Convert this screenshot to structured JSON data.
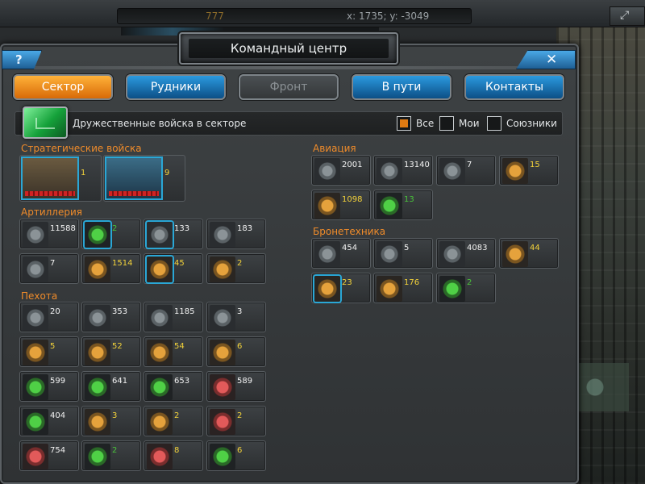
{
  "topbar": {
    "value": "777",
    "coords": "x: 1735; y: -3049"
  },
  "window": {
    "title": "Командный центр",
    "help": "?",
    "close": "✕"
  },
  "tabs": [
    {
      "label": "Сектор"
    },
    {
      "label": "Рудники"
    },
    {
      "label": "Фронт"
    },
    {
      "label": "В пути"
    },
    {
      "label": "Контакты"
    }
  ],
  "filter": {
    "label": "Дружественные войска в секторе",
    "options": [
      "Все",
      "Мои",
      "Союзники"
    ]
  },
  "sections": {
    "strategic": "Стратегические войска",
    "artillery": "Артиллерия",
    "infantry": "Пехота",
    "aviation": "Авиация",
    "armor": "Бронетехника"
  },
  "strategic": [
    "1",
    "9"
  ],
  "artillery": [
    "11588",
    "2",
    "133",
    "183",
    "7",
    "1514",
    "45",
    "2"
  ],
  "infantry": [
    "20",
    "353",
    "1185",
    "3",
    "5",
    "52",
    "54",
    "6",
    "599",
    "641",
    "653",
    "589",
    "404",
    "3",
    "2",
    "2",
    "754",
    "2",
    "8",
    "6"
  ],
  "aviation": [
    "2001",
    "13140",
    "7",
    "15",
    "1098",
    "13"
  ],
  "armor": [
    "454",
    "5",
    "4083",
    "44",
    "23",
    "176",
    "2"
  ]
}
